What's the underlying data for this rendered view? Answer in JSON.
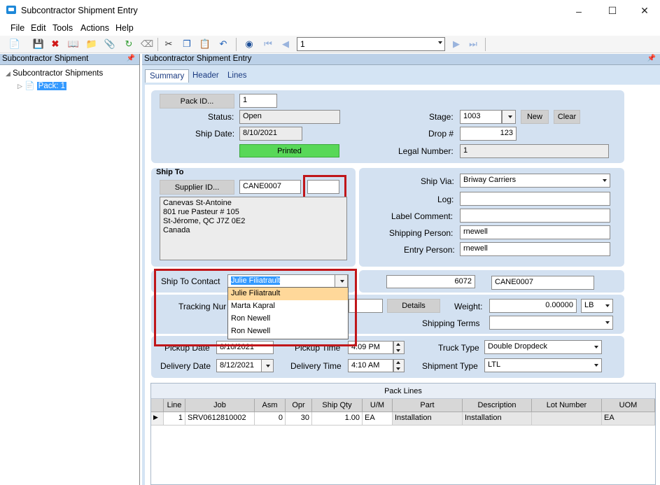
{
  "window": {
    "title": "Subcontractor Shipment Entry",
    "minimize_icon": "minimize-icon",
    "maximize_icon": "maximize-icon",
    "close_icon": "close-icon"
  },
  "menu": [
    "File",
    "Edit",
    "Tools",
    "Actions",
    "Help"
  ],
  "toolbar": {
    "record_number": "1"
  },
  "tree_panel": {
    "title": "Subcontractor Shipment",
    "root": "Subcontractor Shipments",
    "child": "Pack: 1"
  },
  "main_panel": {
    "title": "Subcontractor Shipment Entry"
  },
  "tabs": [
    "Summary",
    "Header",
    "Lines"
  ],
  "summary": {
    "pack_id_button": "Pack ID...",
    "pack_id": "1",
    "status_label": "Status:",
    "status": "Open",
    "ship_date_label": "Ship Date:",
    "ship_date": "8/10/2021",
    "printed": "Printed",
    "stage_label": "Stage:",
    "stage": "1003",
    "new_button": "New",
    "clear_button": "Clear",
    "drop_label": "Drop #",
    "drop_number": "123",
    "legal_number_label": "Legal Number:",
    "legal_number": "1"
  },
  "ship_to": {
    "heading": "Ship To",
    "supplier_button": "Supplier ID...",
    "supplier_id": "CANE0007",
    "supplier_extra": "",
    "address": [
      "Canevas St-Antoine",
      "801 rue Pasteur # 105",
      "St-Jérome, QC  J7Z 0E2",
      "Canada"
    ]
  },
  "shipping": {
    "ship_via_label": "Ship Via:",
    "ship_via": "Briway Carriers",
    "log_label": "Log:",
    "log": "",
    "label_comment_label": "Label Comment:",
    "label_comment": "",
    "shipping_person_label": "Shipping Person:",
    "shipping_person": "rnewell",
    "entry_person_label": "Entry Person:",
    "entry_person": "rnewell"
  },
  "contact": {
    "label": "Ship To Contact",
    "selected": "Julie Filiatrault",
    "options": [
      "Julie Filiatrault",
      "Marta Kapral",
      "Ron Newell",
      "Ron Newell"
    ],
    "number": "6072",
    "supplier_code": "CANE0007"
  },
  "tracking": {
    "label": "Tracking Nur",
    "details_button": "Details",
    "weight_label": "Weight:",
    "weight": "0.00000",
    "weight_uom": "LB",
    "shipping_terms_label": "Shipping Terms",
    "shipping_terms": ""
  },
  "delivery": {
    "pickup_date_label": "Pickup Date",
    "pickup_date": "8/10/2021",
    "pickup_time_label": "Pickup Time",
    "pickup_time": "4:09 PM",
    "delivery_date_label": "Delivery Date",
    "delivery_date": "8/12/2021",
    "delivery_time_label": "Delivery Time",
    "delivery_time": "4:10 AM",
    "truck_type_label": "Truck Type",
    "truck_type": "Double Dropdeck",
    "shipment_type_label": "Shipment Type",
    "shipment_type": "LTL"
  },
  "pack_lines": {
    "title": "Pack Lines",
    "columns": [
      "Line",
      "Job",
      "Asm",
      "Opr",
      "Ship Qty",
      "U/M",
      "Part",
      "Description",
      "Lot Number",
      "UOM"
    ],
    "rows": [
      [
        "1",
        "SRV0612810002",
        "0",
        "30",
        "1.00",
        "EA",
        "Installation",
        "Installation",
        "",
        "EA"
      ]
    ]
  },
  "colors": {
    "accent": "#d4e4f4",
    "highlight": "#c0161a",
    "printed": "#58d858"
  }
}
